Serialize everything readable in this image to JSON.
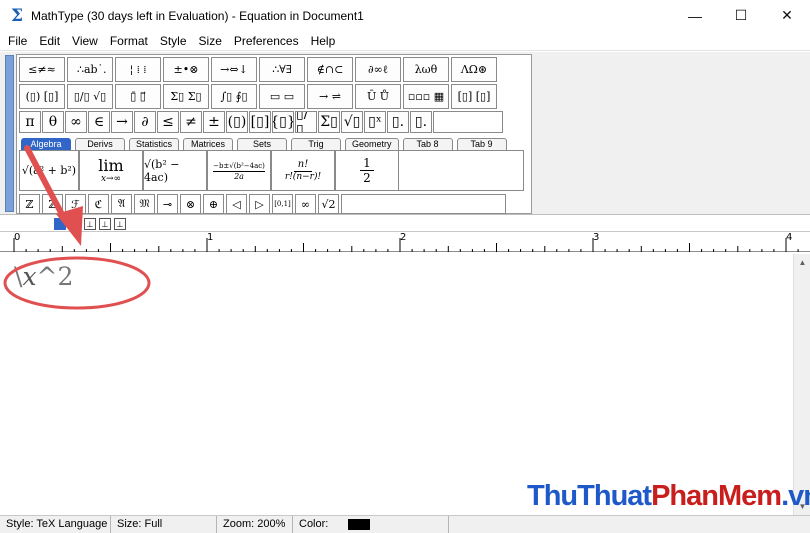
{
  "window": {
    "title": "MathType (30 days left in Evaluation) - Equation in Document1",
    "app_icon": "sigma-icon"
  },
  "window_controls": {
    "minimize": "—",
    "maximize": "☐",
    "close": "✕"
  },
  "menu": [
    "File",
    "Edit",
    "View",
    "Format",
    "Style",
    "Size",
    "Preferences",
    "Help"
  ],
  "palette": {
    "symbol_row1": [
      "≤≠≈",
      " ∴ab˙.",
      "¦ ⁞ ⁞",
      "±•⊗",
      "→⇔↓",
      "∴∀∃",
      "∉∩⊂",
      "∂∞ℓ",
      "λωθ",
      "ΛΩ⊛"
    ],
    "symbol_row2": [
      "(▯) [▯]",
      "▯/▯ √▯",
      "▯̄ ▯⃗",
      "Σ▯ Σ▯",
      "∫▯ ∮▯",
      "▭ ▭",
      "→ ⇌",
      "Ū Ů",
      "▫▫▫ ▦",
      "[▯] [▯]"
    ],
    "symbol_row3": [
      "π",
      "θ",
      "∞",
      "∈",
      "→",
      "∂",
      "≤",
      "≠",
      "±",
      "(▯)",
      "[▯]",
      "{▯}",
      "▯/▯",
      "Σ▯",
      "√▯",
      "▯ˣ",
      "▯.",
      "▯."
    ],
    "tabs": [
      "Algebra",
      "Derivs",
      "Statistics",
      "Matrices",
      "Sets",
      "Trig",
      "Geometry",
      "Tab 8",
      "Tab 9"
    ],
    "active_tab": "Algebra",
    "templates": [
      "√(a² + b²)",
      "lim",
      "x→∞",
      "√(b² − 4ac)",
      "−b±√(b²−4ac)",
      "2a",
      "n!",
      "r!(n−r)!",
      "1",
      "2"
    ],
    "small_row": [
      "ℤ",
      "ℤ",
      "ℱ",
      "ℭ",
      "𝔄",
      "𝔐",
      "⊸",
      "⊗",
      "⊕",
      "◁",
      "▷",
      "[0,1]",
      "∞",
      "√2"
    ]
  },
  "ruler": {
    "marks": [
      "0",
      "1",
      "2",
      "3",
      "4"
    ]
  },
  "editor": {
    "backslash": "\\",
    "variable": "x",
    "rest": "^2"
  },
  "status": {
    "style": "Style: TeX Language",
    "size": "Size: Full",
    "zoom": "Zoom: 200%",
    "color_label": "Color:",
    "color_value": "#000000"
  },
  "watermark": {
    "part1": "ThuThuat",
    "part2": "PhanMem",
    "part3": ".vn"
  },
  "colors": {
    "accent": "#2f66c8",
    "annotation": "#e05050"
  }
}
